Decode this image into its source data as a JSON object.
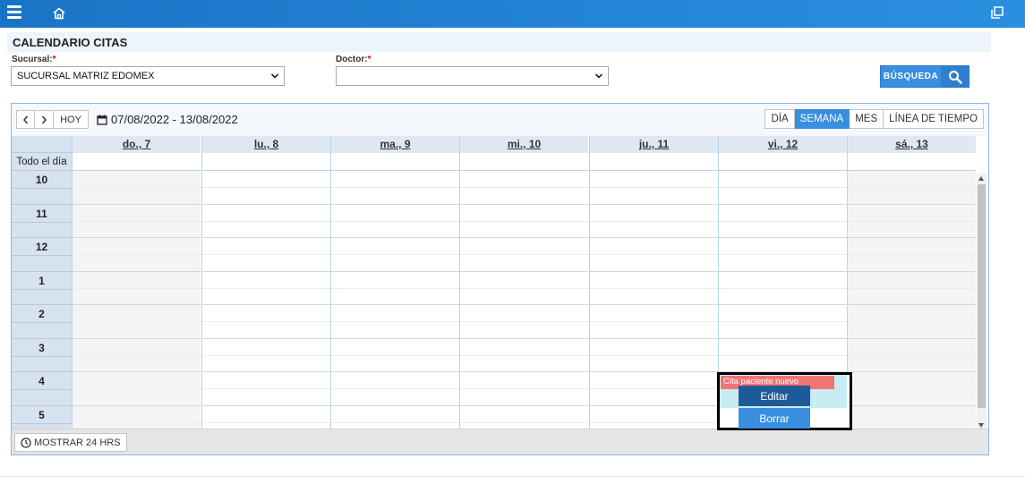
{
  "page": {
    "title": "CALENDARIO CITAS"
  },
  "filters": {
    "sucursal_label": "Sucursal:",
    "sucursal_value": "SUCURSAL MATRIZ EDOMEX",
    "doctor_label": "Doctor:",
    "doctor_value": "",
    "required_mark": "*",
    "search_label": "BÚSQUEDA"
  },
  "calendar": {
    "prev_icon": "chevron-left-icon",
    "next_icon": "chevron-right-icon",
    "today_label": "HOY",
    "date_range": "07/08/2022 - 13/08/2022",
    "views": [
      {
        "label": "DÍA",
        "active": false
      },
      {
        "label": "SEMANA",
        "active": true
      },
      {
        "label": "MES",
        "active": false
      },
      {
        "label": "LÍNEA DE TIEMPO",
        "active": false
      }
    ],
    "all_day_label": "Todo el día",
    "days": [
      "do., 7",
      "lu., 8",
      "ma., 9",
      "mi., 10",
      "ju., 11",
      "vi., 12",
      "sá., 13"
    ],
    "hours": [
      "10",
      "11",
      "12",
      "1",
      "2",
      "3",
      "4",
      "5"
    ],
    "footer_label": "MOSTRAR 24 HRS"
  },
  "event": {
    "title": "Cita paciente nuevo",
    "color": "#f27474"
  },
  "context_menu": {
    "edit_label": "Editar",
    "delete_label": "Borrar"
  },
  "colors": {
    "topbar": "#1a74c6",
    "accent": "#3a8ee0"
  }
}
